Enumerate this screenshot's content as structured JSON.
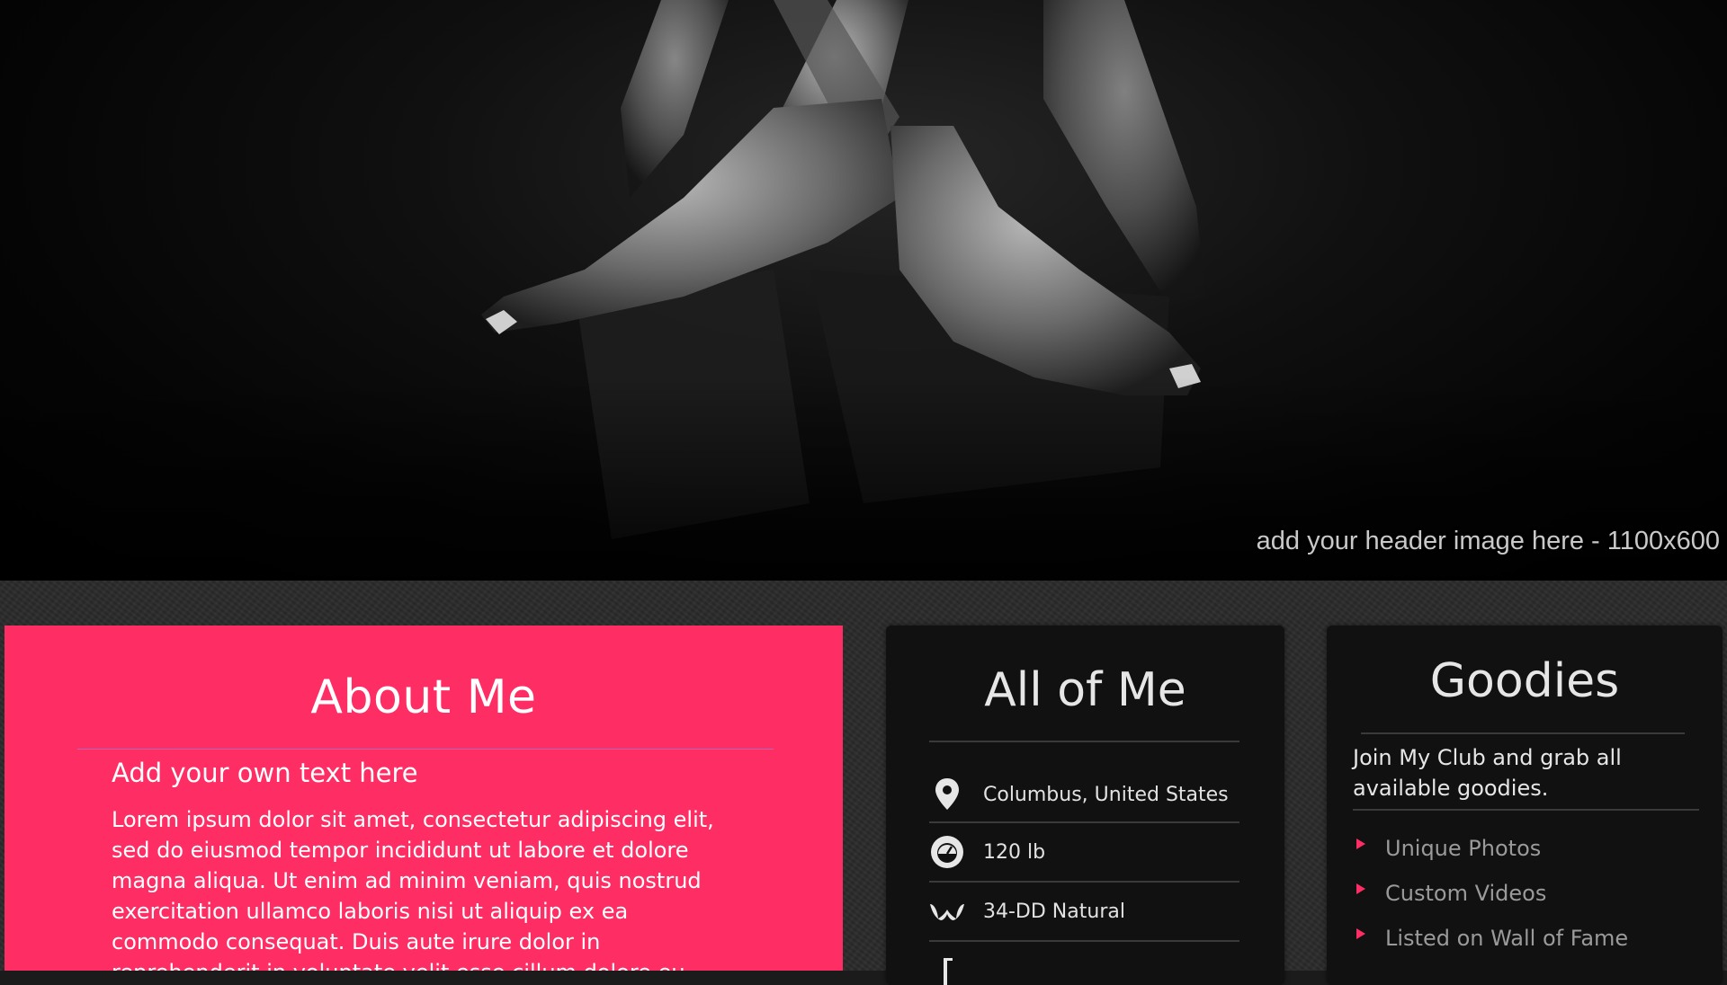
{
  "header": {
    "caption": "add your header image here - 1100x600"
  },
  "about": {
    "title": "About Me",
    "subtitle": "Add your own text here",
    "body": "Lorem ipsum dolor sit amet, consectetur adipiscing elit, sed do eiusmod tempor incididunt ut labore et dolore magna aliqua. Ut enim ad minim veniam, quis nostrud exercitation ullamco laboris nisi ut aliquip ex ea commodo consequat. Duis aute irure dolor in reprehenderit in voluptate velit esse cillum dolore eu"
  },
  "all_of_me": {
    "title": "All of Me",
    "stats": [
      {
        "icon": "location-pin-icon",
        "text": "Columbus, United States"
      },
      {
        "icon": "weight-scale-icon",
        "text": "120 lb"
      },
      {
        "icon": "bra-icon",
        "text": "34-DD Natural"
      },
      {
        "icon": "height-icon",
        "text": ""
      }
    ]
  },
  "goodies": {
    "title": "Goodies",
    "intro": "Join My Club and grab all available goodies.",
    "items": [
      {
        "label": "Unique Photos"
      },
      {
        "label": "Custom Videos"
      },
      {
        "label": "Listed on Wall of Fame"
      }
    ]
  },
  "colors": {
    "accent": "#fe2e64",
    "panel_bg": "#111111",
    "text_light": "#e6e6e6",
    "text_muted": "#9a9a9a"
  }
}
